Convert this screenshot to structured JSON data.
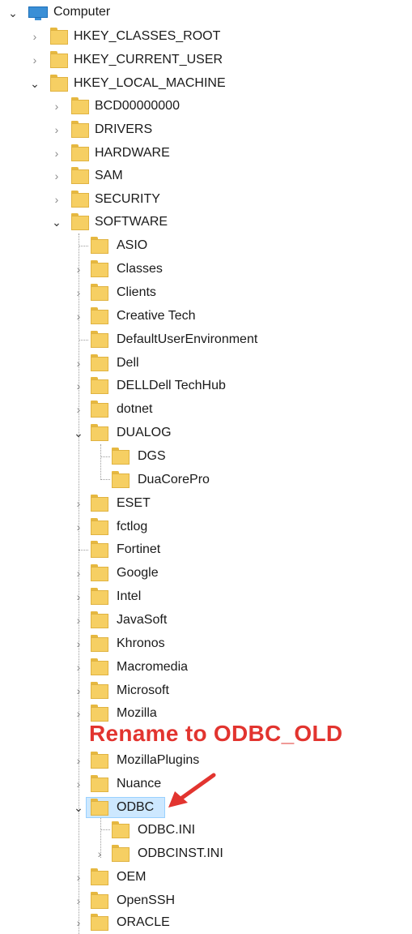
{
  "tree": {
    "root": "Computer",
    "hkey_classes_root": "HKEY_CLASSES_ROOT",
    "hkey_current_user": "HKEY_CURRENT_USER",
    "hkey_local_machine": "HKEY_LOCAL_MACHINE",
    "hklm_children": [
      "BCD00000000",
      "DRIVERS",
      "HARDWARE",
      "SAM",
      "SECURITY",
      "SOFTWARE"
    ],
    "software_children": [
      "ASIO",
      "Classes",
      "Clients",
      "Creative Tech",
      "DefaultUserEnvironment",
      "Dell",
      "DELLDell TechHub",
      "dotnet",
      "DUALOG"
    ],
    "dualog_children": [
      "DGS",
      "DuaCorePro"
    ],
    "software_children_2": [
      "ESET",
      "fctlog",
      "Fortinet",
      "Google",
      "Intel",
      "JavaSoft",
      "Khronos",
      "Macromedia",
      "Microsoft",
      "Mozilla",
      "MozillaPlugins",
      "Nuance"
    ],
    "selected": "ODBC",
    "odbc_children": [
      "ODBC.INI",
      "ODBCINST.INI"
    ],
    "software_children_3": [
      "OEM",
      "OpenSSH",
      "ORACLE"
    ]
  },
  "annotation": {
    "text": "Rename to ODBC_OLD",
    "color": "#e2342f"
  },
  "colors": {
    "selection_bg": "#cde8ff",
    "selection_border": "#99d1ff",
    "folder": "#f6cf63"
  },
  "icons": {
    "computer": "monitor-icon",
    "folder": "folder-icon",
    "expanded": "chevron-down-icon",
    "collapsed": "chevron-right-icon"
  }
}
